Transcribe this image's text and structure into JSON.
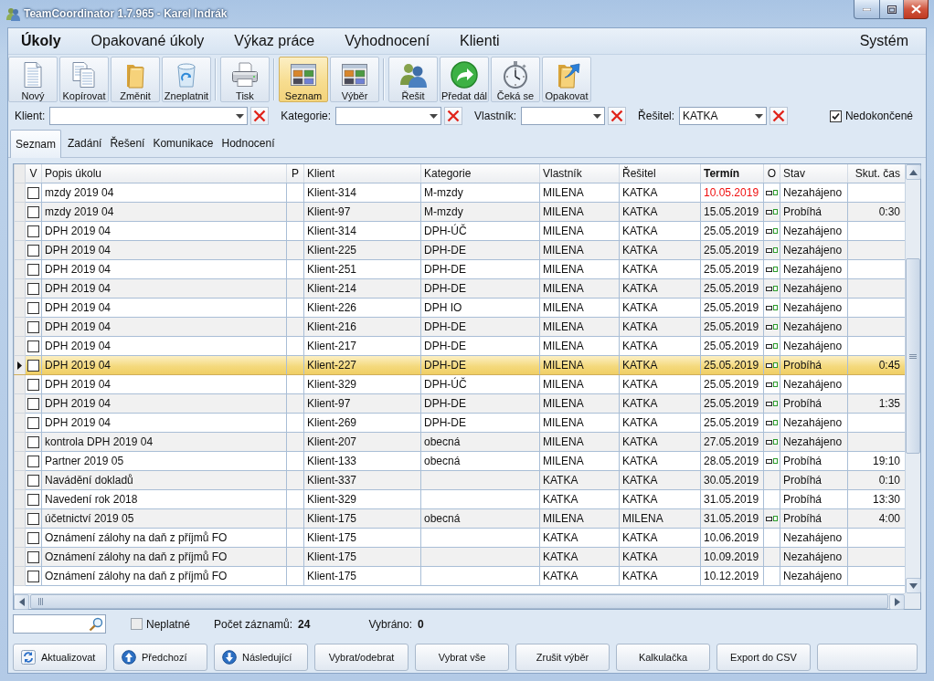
{
  "window": {
    "title": "TeamCoordinator 1.7.965 - Karel Indrák"
  },
  "menu": {
    "items": [
      {
        "label": "Úkoly",
        "selected": true
      },
      {
        "label": "Opakované úkoly",
        "selected": false
      },
      {
        "label": "Výkaz práce",
        "selected": false
      },
      {
        "label": "Vyhodnocení",
        "selected": false
      },
      {
        "label": "Klienti",
        "selected": false
      }
    ],
    "right_items": [
      {
        "label": "Systém",
        "selected": false
      }
    ]
  },
  "toolbar": {
    "groups": [
      {
        "buttons": [
          {
            "label": "Nový",
            "selected": false
          },
          {
            "label": "Kopírovat",
            "selected": false
          },
          {
            "label": "Změnit",
            "selected": false
          },
          {
            "label": "Zneplatnit",
            "selected": false
          }
        ]
      },
      {
        "buttons": [
          {
            "label": "Tisk",
            "selected": false
          }
        ]
      },
      {
        "buttons": [
          {
            "label": "Seznam",
            "selected": true
          },
          {
            "label": "Výběr",
            "selected": false
          }
        ]
      },
      {
        "buttons": [
          {
            "label": "Řešit",
            "selected": false
          },
          {
            "label": "Předat dál",
            "selected": false
          },
          {
            "label": "Čeká se",
            "selected": false
          },
          {
            "label": "Opakovat",
            "selected": false
          }
        ]
      }
    ]
  },
  "filters": [
    {
      "label": "Klient:"
    },
    {
      "label": "Kategorie:"
    },
    {
      "label": "Vlastník:"
    },
    {
      "label": "Řešitel:",
      "value": "KATKA"
    }
  ],
  "unfinished_checkbox": {
    "label": "Nedokončené",
    "checked": true
  },
  "tabs": [
    {
      "label": "Seznam",
      "selected": true
    },
    {
      "label": "Zadání",
      "selected": false
    },
    {
      "label": "Řešení",
      "selected": false
    },
    {
      "label": "Komunikace",
      "selected": false
    },
    {
      "label": "Hodnocení",
      "selected": false
    }
  ],
  "table": {
    "columns": [
      {
        "label": "V",
        "sorted": false
      },
      {
        "label": "Popis úkolu",
        "sorted": false
      },
      {
        "label": "P",
        "sorted": false
      },
      {
        "label": "Klient",
        "sorted": false
      },
      {
        "label": "Kategorie",
        "sorted": false
      },
      {
        "label": "Vlastník",
        "sorted": false
      },
      {
        "label": "Řešitel",
        "sorted": false
      },
      {
        "label": "Termín",
        "sorted": true
      },
      {
        "label": "O",
        "sorted": false
      },
      {
        "label": "Stav",
        "sorted": false
      },
      {
        "label": "Skut. čas",
        "sorted": false
      }
    ],
    "rows": [
      {
        "checked": false,
        "description": "mzdy 2019 04",
        "client": "Klient-314",
        "category": "M-mzdy",
        "owner": "MILENA",
        "solver": "KATKA",
        "deadline": "10.05.2019",
        "overdue": true,
        "o_marker": true,
        "status": "Nezahájeno",
        "selected": false
      },
      {
        "checked": false,
        "description": "mzdy 2019 04",
        "client": "Klient-97",
        "category": "M-mzdy",
        "owner": "MILENA",
        "solver": "KATKA",
        "deadline": "15.05.2019",
        "overdue": false,
        "o_marker": true,
        "status": "Probíhá",
        "time": "0:30",
        "selected": false
      },
      {
        "checked": false,
        "description": "DPH 2019 04",
        "client": "Klient-314",
        "category": "DPH-ÚČ",
        "owner": "MILENA",
        "solver": "KATKA",
        "deadline": "25.05.2019",
        "overdue": false,
        "o_marker": true,
        "status": "Nezahájeno",
        "selected": false
      },
      {
        "checked": false,
        "description": "DPH 2019 04",
        "client": "Klient-225",
        "category": "DPH-DE",
        "owner": "MILENA",
        "solver": "KATKA",
        "deadline": "25.05.2019",
        "overdue": false,
        "o_marker": true,
        "status": "Nezahájeno",
        "selected": false
      },
      {
        "checked": false,
        "description": "DPH 2019 04",
        "client": "Klient-251",
        "category": "DPH-DE",
        "owner": "MILENA",
        "solver": "KATKA",
        "deadline": "25.05.2019",
        "overdue": false,
        "o_marker": true,
        "status": "Nezahájeno",
        "selected": false
      },
      {
        "checked": false,
        "description": "DPH 2019 04",
        "client": "Klient-214",
        "category": "DPH-DE",
        "owner": "MILENA",
        "solver": "KATKA",
        "deadline": "25.05.2019",
        "overdue": false,
        "o_marker": true,
        "status": "Nezahájeno",
        "selected": false
      },
      {
        "checked": false,
        "description": "DPH 2019 04",
        "client": "Klient-226",
        "category": "DPH IO",
        "owner": "MILENA",
        "solver": "KATKA",
        "deadline": "25.05.2019",
        "overdue": false,
        "o_marker": true,
        "status": "Nezahájeno",
        "selected": false
      },
      {
        "checked": false,
        "description": "DPH 2019 04",
        "client": "Klient-216",
        "category": "DPH-DE",
        "owner": "MILENA",
        "solver": "KATKA",
        "deadline": "25.05.2019",
        "overdue": false,
        "o_marker": true,
        "status": "Nezahájeno",
        "selected": false
      },
      {
        "checked": false,
        "description": "DPH 2019 04",
        "client": "Klient-217",
        "category": "DPH-DE",
        "owner": "MILENA",
        "solver": "KATKA",
        "deadline": "25.05.2019",
        "overdue": false,
        "o_marker": true,
        "status": "Nezahájeno",
        "selected": false
      },
      {
        "checked": false,
        "description": "DPH 2019 04",
        "client": "Klient-227",
        "category": "DPH-DE",
        "owner": "MILENA",
        "solver": "KATKA",
        "deadline": "25.05.2019",
        "overdue": false,
        "o_marker": true,
        "status": "Probíhá",
        "time": "0:45",
        "selected": true
      },
      {
        "checked": false,
        "description": "DPH 2019 04",
        "client": "Klient-329",
        "category": "DPH-ÚČ",
        "owner": "MILENA",
        "solver": "KATKA",
        "deadline": "25.05.2019",
        "overdue": false,
        "o_marker": true,
        "status": "Nezahájeno",
        "selected": false
      },
      {
        "checked": false,
        "description": "DPH 2019 04",
        "client": "Klient-97",
        "category": "DPH-DE",
        "owner": "MILENA",
        "solver": "KATKA",
        "deadline": "25.05.2019",
        "overdue": false,
        "o_marker": true,
        "status": "Probíhá",
        "time": "1:35",
        "selected": false
      },
      {
        "checked": false,
        "description": "DPH 2019 04",
        "client": "Klient-269",
        "category": "DPH-DE",
        "owner": "MILENA",
        "solver": "KATKA",
        "deadline": "25.05.2019",
        "overdue": false,
        "o_marker": true,
        "status": "Nezahájeno",
        "selected": false
      },
      {
        "checked": false,
        "description": "kontrola DPH 2019 04",
        "client": "Klient-207",
        "category": "obecná",
        "owner": "MILENA",
        "solver": "KATKA",
        "deadline": "27.05.2019",
        "overdue": false,
        "o_marker": true,
        "status": "Nezahájeno",
        "selected": false
      },
      {
        "checked": false,
        "description": "Partner 2019 05",
        "client": "Klient-133",
        "category": "obecná",
        "owner": "MILENA",
        "solver": "KATKA",
        "deadline": "28.05.2019",
        "overdue": false,
        "o_marker": true,
        "status": "Probíhá",
        "time": "19:10",
        "selected": false
      },
      {
        "checked": false,
        "description": "Navádění dokladů",
        "client": "Klient-337",
        "owner": "KATKA",
        "solver": "KATKA",
        "deadline": "30.05.2019",
        "overdue": false,
        "o_marker": false,
        "status": "Probíhá",
        "time": "0:10",
        "selected": false
      },
      {
        "checked": false,
        "description": "Navedení rok 2018",
        "client": "Klient-329",
        "owner": "KATKA",
        "solver": "KATKA",
        "deadline": "31.05.2019",
        "overdue": false,
        "o_marker": false,
        "status": "Probíhá",
        "time": "13:30",
        "selected": false
      },
      {
        "checked": false,
        "description": "účetnictví 2019 05",
        "client": "Klient-175",
        "category": "obecná",
        "owner": "MILENA",
        "solver": "MILENA",
        "deadline": "31.05.2019",
        "overdue": false,
        "o_marker": true,
        "status": "Probíhá",
        "time": "4:00",
        "selected": false
      },
      {
        "checked": false,
        "description": "Oznámení zálohy na daň z příjmů FO",
        "client": "Klient-175",
        "owner": "KATKA",
        "solver": "KATKA",
        "deadline": "10.06.2019",
        "overdue": false,
        "o_marker": false,
        "status": "Nezahájeno",
        "selected": false
      },
      {
        "checked": false,
        "description": "Oznámení zálohy na daň z příjmů FO",
        "client": "Klient-175",
        "owner": "KATKA",
        "solver": "KATKA",
        "deadline": "10.09.2019",
        "overdue": false,
        "o_marker": false,
        "status": "Nezahájeno",
        "selected": false
      },
      {
        "checked": false,
        "description": "Oznámení zálohy na daň z příjmů FO",
        "client": "Klient-175",
        "owner": "KATKA",
        "solver": "KATKA",
        "deadline": "10.12.2019",
        "overdue": false,
        "o_marker": false,
        "status": "Nezahájeno",
        "selected": false
      }
    ]
  },
  "invalid_checkbox": {
    "label": "Neplatné",
    "checked": false
  },
  "stats": [
    {
      "label": "Počet záznamů:",
      "value": "24"
    },
    {
      "label": "Vybráno:",
      "value": "0"
    }
  ],
  "bottom_buttons": [
    {
      "kind": "icon",
      "label": "Aktualizovat"
    },
    {
      "kind": "icon",
      "label": "Předchozí"
    },
    {
      "kind": "icon",
      "label": "Následující"
    },
    {
      "kind": "text",
      "label": "Vybrat/odebrat"
    },
    {
      "kind": "text",
      "label": "Vybrat vše"
    },
    {
      "kind": "text",
      "label": "Zrušit výběr"
    },
    {
      "kind": "text",
      "label": "Kalkulačka"
    },
    {
      "kind": "text",
      "label": "Export do CSV"
    },
    {
      "kind": "blank"
    }
  ]
}
